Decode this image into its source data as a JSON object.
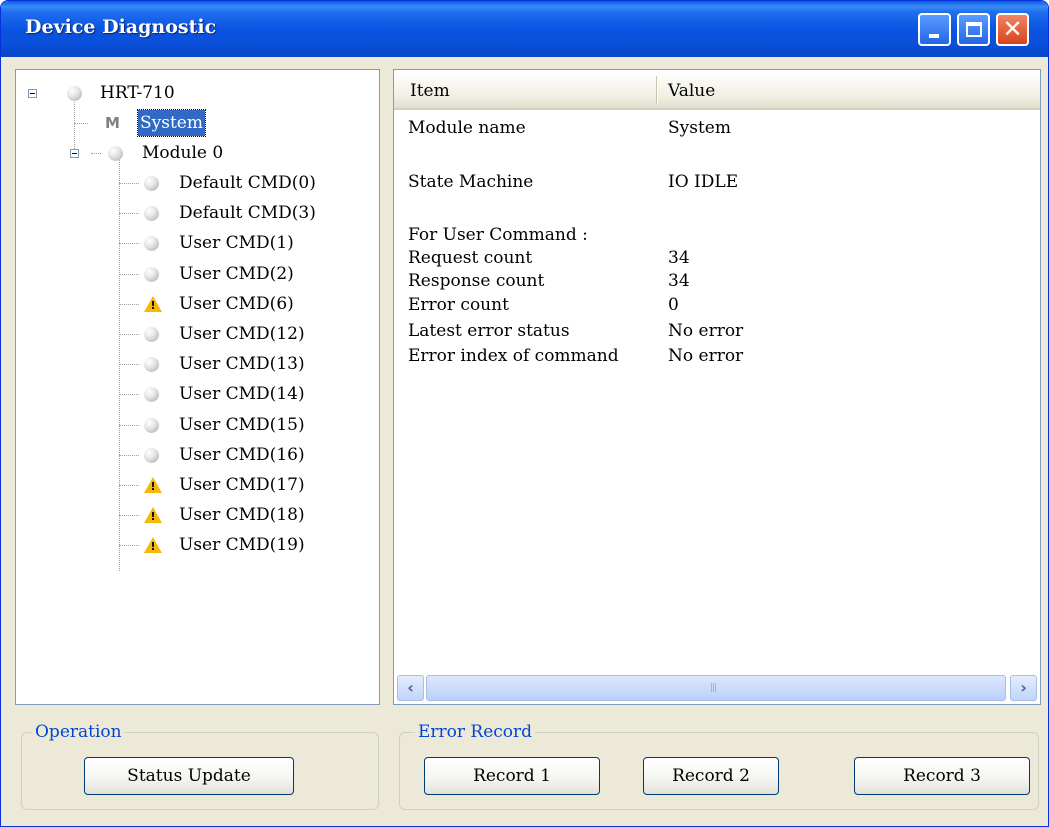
{
  "window": {
    "title": "Device Diagnostic",
    "close_glyph": "✕"
  },
  "tree": {
    "root": {
      "label": "HRT-710",
      "icon": "status-bulb-icon"
    },
    "system": {
      "label": "System",
      "icon": "module-m-icon",
      "icon_text": "M",
      "selected": true
    },
    "module": {
      "label": "Module 0",
      "icon": "status-bulb-icon"
    },
    "commands": [
      {
        "label": "Default CMD(0)",
        "status": "normal"
      },
      {
        "label": "Default CMD(3)",
        "status": "normal"
      },
      {
        "label": "User CMD(1)",
        "status": "normal"
      },
      {
        "label": "User CMD(2)",
        "status": "normal"
      },
      {
        "label": "User CMD(6)",
        "status": "warning"
      },
      {
        "label": "User CMD(12)",
        "status": "normal"
      },
      {
        "label": "User CMD(13)",
        "status": "normal"
      },
      {
        "label": "User CMD(14)",
        "status": "normal"
      },
      {
        "label": "User CMD(15)",
        "status": "normal"
      },
      {
        "label": "User CMD(16)",
        "status": "normal"
      },
      {
        "label": "User CMD(17)",
        "status": "warning"
      },
      {
        "label": "User CMD(18)",
        "status": "warning"
      },
      {
        "label": "User CMD(19)",
        "status": "warning"
      }
    ]
  },
  "details": {
    "columns": {
      "item": "Item",
      "value": "Value"
    },
    "rows": [
      {
        "item": "Module name",
        "value": "System"
      },
      {
        "item": "State Machine",
        "value": "IO IDLE"
      },
      {
        "item": "For User Command :",
        "value": ""
      },
      {
        "item": "Request count",
        "value": "34"
      },
      {
        "item": "Response count",
        "value": "34"
      },
      {
        "item": "Error count",
        "value": "0"
      },
      {
        "item": "Latest error status",
        "value": "No error"
      },
      {
        "item": "Error index of command",
        "value": "No error"
      }
    ],
    "scroll_left_glyph": "‹",
    "scroll_right_glyph": "›",
    "grip_glyph": "|||"
  },
  "operation": {
    "legend": "Operation",
    "status_update_label": "Status Update"
  },
  "error_record": {
    "legend": "Error Record",
    "record_labels": [
      "Record 1",
      "Record 2",
      "Record 3"
    ]
  },
  "colors": {
    "title_bar": "#0a54e2",
    "selection": "#316ac5",
    "warning": "#f6b80a",
    "group_legend": "#0046d5"
  }
}
